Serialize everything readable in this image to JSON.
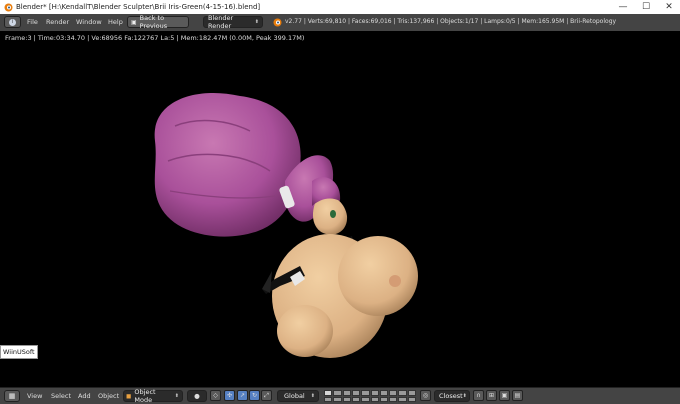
{
  "window": {
    "title": "Blender* [H:\\KendallT\\Blender Sculpter\\Brii Iris-Green(4-15-16).blend]",
    "minimize": "—",
    "maximize": "☐",
    "close": "✕"
  },
  "topbar": {
    "menus": [
      "File",
      "Render",
      "Window",
      "Help"
    ],
    "back_button": "Back to Previous",
    "render_engine": "Blender Render",
    "stats": "v2.77 | Verts:69,810 | Faces:69,016 | Tris:137,966 | Objects:1/17 | Lamps:0/5 | Mem:165.95M | Brii-Retopology"
  },
  "viewport": {
    "info": "Frame:3 | Time:03:34.70 | Ve:68956 Fa:122767 La:5 | Mem:182.47M (0.00M, Peak 399.17M)",
    "watermark": "WiinUSoft"
  },
  "bottombar": {
    "menus": [
      "View",
      "Select",
      "Add",
      "Object"
    ],
    "mode": "Object Mode",
    "orientation": "Global",
    "snap": "Closest"
  },
  "colors": {
    "hair": "#b0589c",
    "skin": "#e2bb8c",
    "bar": "#444444",
    "accent": "#5680c2"
  }
}
